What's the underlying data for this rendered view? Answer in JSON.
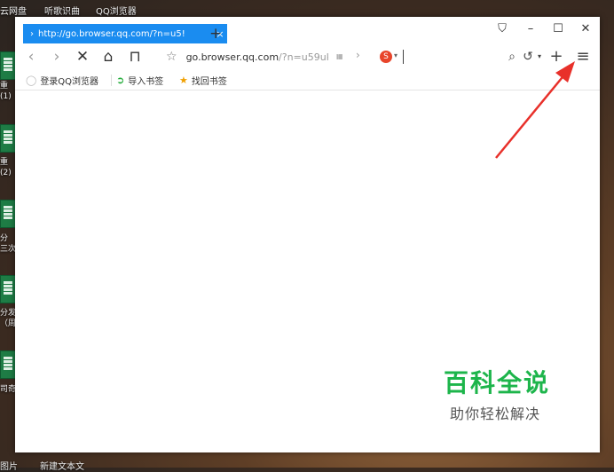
{
  "desktop": {
    "top_labels": [
      "云网盘",
      "听歌识曲",
      "QQ浏览器"
    ],
    "left_labels": [
      "重",
      "(1)",
      "重",
      "(2)",
      "分",
      "三次",
      "分发",
      "（周",
      "司奇("
    ],
    "bottom_labels": [
      "图片",
      "新建文本文"
    ]
  },
  "browser": {
    "tab": {
      "title": "http://go.browser.qq.com/?n=u5!",
      "close": "×",
      "chevron": "›"
    },
    "new_tab": "+",
    "window_controls": {
      "pin": "⛉",
      "minimize": "–",
      "maximize": "☐",
      "close": "✕"
    },
    "toolbar": {
      "back": "‹",
      "forward": "›",
      "stop": "✕",
      "home": "⌂",
      "reader": "⊓",
      "star": "☆",
      "address": "go.browser.qq.com",
      "address_dim": "/?n=u59uk",
      "qr": "▦",
      "addr_arrow": "›",
      "engine": "S",
      "engine_caret": "▾",
      "search_icon": "⌕",
      "undo": "↺",
      "undo_caret": "▾",
      "plus": "+",
      "menu": "≡"
    },
    "bookmarks": [
      {
        "icon": "◯",
        "label": "登录QQ浏览器"
      },
      {
        "icon": "➲",
        "label": "导入书签"
      },
      {
        "icon": "★",
        "label": "找回书签"
      }
    ]
  },
  "watermark": {
    "title": "百科全说",
    "subtitle": "助你轻松解决"
  },
  "colors": {
    "tab_active": "#1a8cf0",
    "watermark_green": "#1db54b",
    "arrow_red": "#e8302a"
  }
}
